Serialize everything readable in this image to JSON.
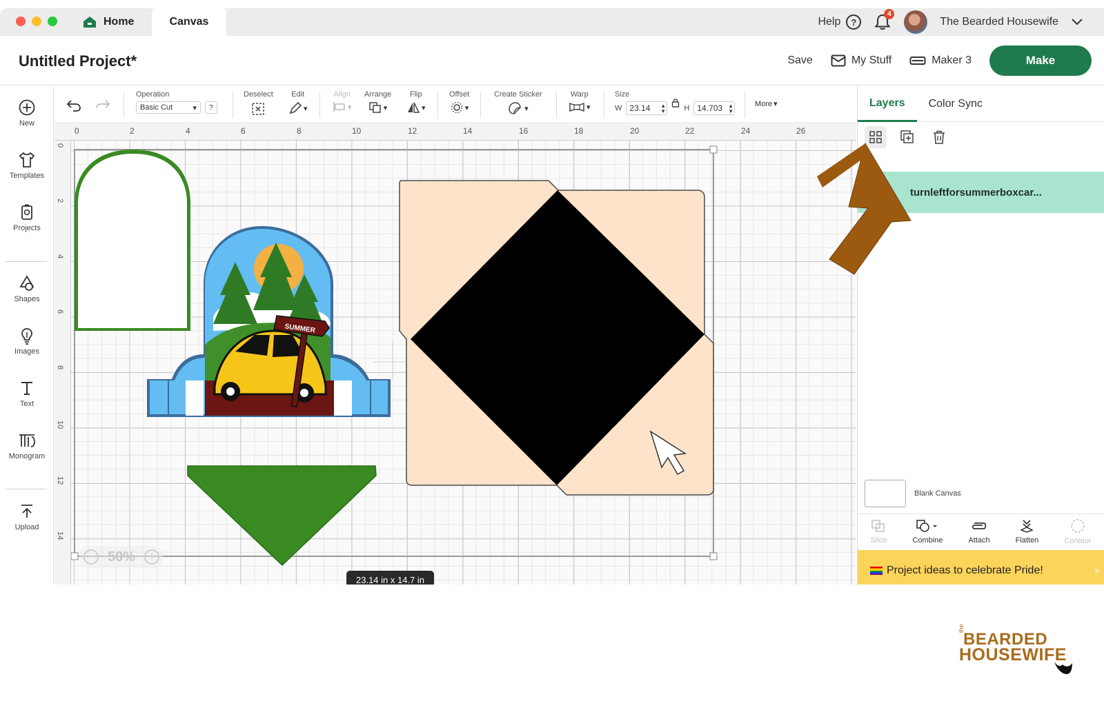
{
  "titlebar": {
    "tabs": [
      {
        "label": "Home"
      },
      {
        "label": "Canvas"
      }
    ],
    "help_label": "Help",
    "help_icon_glyph": "?",
    "notification_count": "4",
    "user_name": "The Bearded Housewife"
  },
  "header": {
    "project_title": "Untitled Project*",
    "save_label": "Save",
    "my_stuff_label": "My Stuff",
    "machine_label": "Maker 3",
    "make_label": "Make"
  },
  "sidebar": {
    "items": [
      {
        "label": "New",
        "icon": "plus-circle-icon"
      },
      {
        "label": "Templates",
        "icon": "shirt-icon"
      },
      {
        "label": "Projects",
        "icon": "projects-icon"
      },
      {
        "label": "Shapes",
        "icon": "shapes-icon"
      },
      {
        "label": "Images",
        "icon": "lightbulb-icon"
      },
      {
        "label": "Text",
        "icon": "text-icon"
      },
      {
        "label": "Monogram",
        "icon": "monogram-icon"
      },
      {
        "label": "Upload",
        "icon": "upload-icon"
      }
    ]
  },
  "toolbar": {
    "operation_label": "Operation",
    "operation_value": "Basic Cut",
    "operation_help": "?",
    "deselect_label": "Deselect",
    "edit_label": "Edit",
    "align_label": "Align",
    "arrange_label": "Arrange",
    "flip_label": "Flip",
    "offset_label": "Offset",
    "create_sticker_label": "Create Sticker",
    "warp_label": "Warp",
    "size_label": "Size",
    "width_prefix": "W",
    "width_value": "23.14",
    "height_prefix": "H",
    "height_value": "14.703",
    "more_label": "More"
  },
  "canvas": {
    "ruler_top": [
      "0",
      "2",
      "4",
      "6",
      "8",
      "10",
      "12",
      "14",
      "16",
      "18",
      "20",
      "22",
      "24",
      "26"
    ],
    "ruler_left": [
      "0",
      "2",
      "4",
      "6",
      "8",
      "10",
      "12",
      "14"
    ],
    "zoom_level": "50%",
    "dimensions_tooltip": "23.14  in x 14.7  in",
    "sign_text": "SUMMER",
    "colors": {
      "green": "#3a8a22",
      "sky": "#63bdf2",
      "sun": "#f4b042",
      "car": "#f5c518",
      "dirt": "#6b1612",
      "peach": "#fde3c9",
      "black": "#000000"
    }
  },
  "right_panel": {
    "tabs": [
      {
        "label": "Layers"
      },
      {
        "label": "Color Sync"
      }
    ],
    "layer_name": "turnleftforsummerboxcar...",
    "blank_canvas_label": "Blank Canvas",
    "bottom_actions": [
      {
        "label": "Slice",
        "enabled": false
      },
      {
        "label": "Combine",
        "enabled": true
      },
      {
        "label": "Attach",
        "enabled": true
      },
      {
        "label": "Flatten",
        "enabled": true
      },
      {
        "label": "Contour",
        "enabled": false
      }
    ],
    "promo_text": "Project ideas to celebrate Pride!",
    "promo_close": "×"
  },
  "logo": {
    "small": "the",
    "line1": "BEARDED",
    "line2": "HOUSEWIFE"
  }
}
